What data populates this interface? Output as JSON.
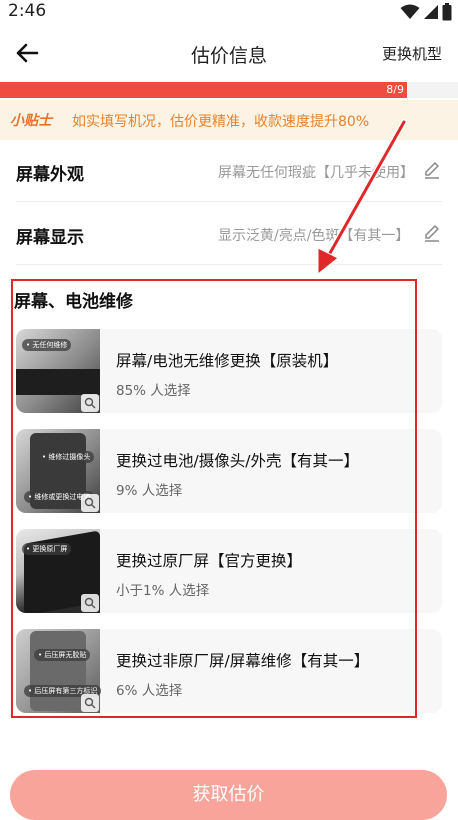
{
  "status_bar": {
    "time": "2:46"
  },
  "nav": {
    "title": "估价信息",
    "action_label": "更换机型"
  },
  "progress": {
    "text": "8/9",
    "fraction": 0.889,
    "fill_color": "#ef4b3f"
  },
  "tip": {
    "label": "小贴士",
    "text": "如实填写机况，估价更精准，收款速度提升80%"
  },
  "specs": [
    {
      "label": "屏幕外观",
      "value": "屏幕无任何瑕疵【几乎未使用】"
    },
    {
      "label": "屏幕显示",
      "value": "显示泛黄/亮点/色斑【有其一】"
    }
  ],
  "section": {
    "title": "屏幕、电池维修",
    "options": [
      {
        "title": "屏幕/电池无维修更换【原装机】",
        "subtitle": "85% 人选择",
        "thumb_tag": "• 无任何维修",
        "thumb_tag2": ""
      },
      {
        "title": "更换过电池/摄像头/外壳【有其一】",
        "subtitle": "9% 人选择",
        "thumb_tag": "• 维修过摄像头",
        "thumb_tag2": "• 维修或更换过电池"
      },
      {
        "title": "更换过原厂屏【官方更换】",
        "subtitle": "小于1% 人选择",
        "thumb_tag": "• 更换原厂屏",
        "thumb_tag2": ""
      },
      {
        "title": "更换过非原厂屏/屏幕维修【有其一】",
        "subtitle": "6% 人选择",
        "thumb_tag": "• 后压屏无胶贴",
        "thumb_tag2": "• 后压屏有第三方标识"
      }
    ]
  },
  "cta": {
    "label": "获取估价"
  },
  "colors": {
    "accent": "#ef4b3f",
    "cta": "#f9a49a",
    "tip_bg": "#fdf3e4",
    "tip_text": "#e8822a",
    "annotation": "#e0282a"
  }
}
